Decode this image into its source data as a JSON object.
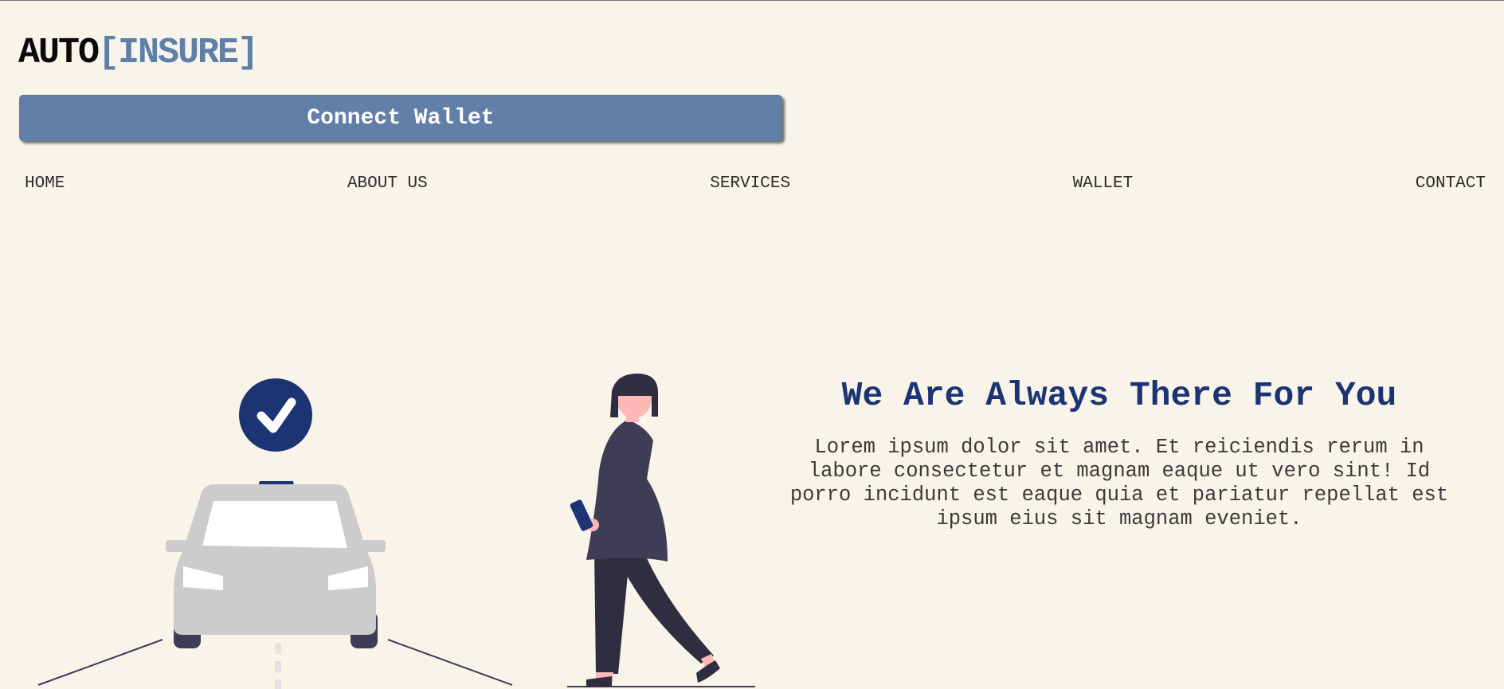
{
  "brand": {
    "main": "AUTO",
    "accent": "[INSURE]"
  },
  "wallet_button": {
    "label": "Connect Wallet"
  },
  "nav": {
    "items": [
      {
        "label": "HOME"
      },
      {
        "label": "ABOUT US"
      },
      {
        "label": "SERVICES"
      },
      {
        "label": "WALLET"
      },
      {
        "label": "CONTACT"
      }
    ]
  },
  "hero": {
    "title": "We Are Always There For You",
    "body": "Lorem ipsum dolor sit amet. Et reiciendis rerum in labore consectetur et magnam eaque ut vero sint! Id porro incidunt est eaque quia et pariatur repellat est ipsum eius sit magnam eveniet."
  },
  "illustration": {
    "icons": [
      "check-badge-icon",
      "car-icon",
      "woman-with-phone-icon"
    ]
  },
  "colors": {
    "background": "#f8f4ea",
    "accent": "#617fa9",
    "title": "#1c3473",
    "car": "#cccccc",
    "figure": "#3f3d56"
  }
}
